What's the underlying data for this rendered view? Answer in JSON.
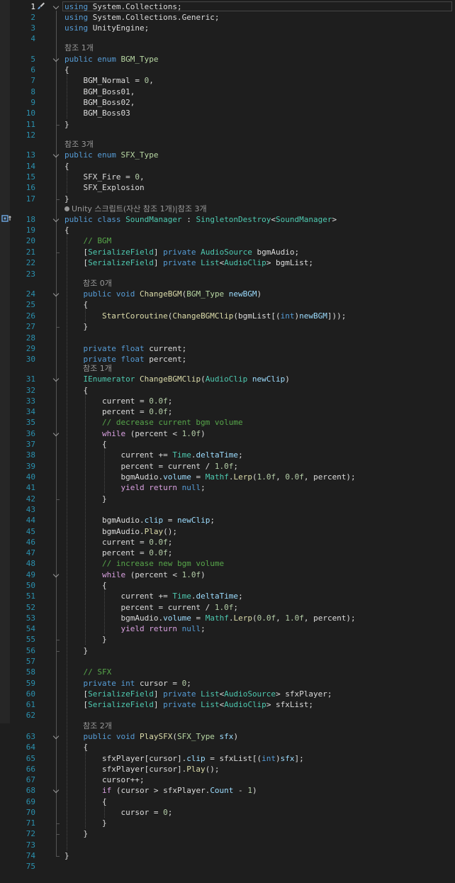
{
  "lenses": {
    "bgm_type": "참조 1개",
    "sfx_type": "참조 3개",
    "sound_manager": "Unity 스크립트(자산 참조 1개)|참조 3개",
    "change_bgm": "참조 0개",
    "change_bgm_clip": "참조 1개",
    "play_sfx": "참조 2개"
  },
  "lines": [
    {
      "n": "1",
      "code": [
        [
          "kw",
          "using"
        ],
        [
          "pl",
          " System.Collections;"
        ]
      ]
    },
    {
      "n": "2",
      "code": [
        [
          "kw",
          "using"
        ],
        [
          "pl",
          " System.Collections.Generic;"
        ]
      ]
    },
    {
      "n": "3",
      "code": [
        [
          "kw",
          "using"
        ],
        [
          "pl",
          " UnityEngine;"
        ]
      ]
    },
    {
      "n": "4",
      "code": []
    },
    {
      "n": "5",
      "code": [
        [
          "kw",
          "public enum "
        ],
        [
          "tyv",
          "BGM_Type"
        ]
      ]
    },
    {
      "n": "6",
      "code": [
        [
          "pl",
          "{"
        ]
      ]
    },
    {
      "n": "7",
      "code": [
        [
          "pl",
          "    BGM_Normal = "
        ],
        [
          "nm",
          "0"
        ],
        [
          "pl",
          ","
        ]
      ]
    },
    {
      "n": "8",
      "code": [
        [
          "pl",
          "    BGM_Boss01,"
        ]
      ]
    },
    {
      "n": "9",
      "code": [
        [
          "pl",
          "    BGM_Boss02,"
        ]
      ]
    },
    {
      "n": "10",
      "code": [
        [
          "pl",
          "    BGM_Boss03"
        ]
      ]
    },
    {
      "n": "11",
      "code": [
        [
          "pl",
          "}"
        ]
      ]
    },
    {
      "n": "12",
      "code": []
    },
    {
      "n": "13",
      "code": [
        [
          "kw",
          "public enum "
        ],
        [
          "tyv",
          "SFX_Type"
        ]
      ]
    },
    {
      "n": "14",
      "code": [
        [
          "pl",
          "{"
        ]
      ]
    },
    {
      "n": "15",
      "code": [
        [
          "pl",
          "    SFX_Fire = "
        ],
        [
          "nm",
          "0"
        ],
        [
          "pl",
          ","
        ]
      ]
    },
    {
      "n": "16",
      "code": [
        [
          "pl",
          "    SFX_Explosion"
        ]
      ]
    },
    {
      "n": "17",
      "code": [
        [
          "pl",
          "}"
        ]
      ]
    },
    {
      "n": "18",
      "code": [
        [
          "kw",
          "public class "
        ],
        [
          "ty",
          "SoundManager"
        ],
        [
          "pl",
          " : "
        ],
        [
          "ty",
          "SingletonDestroy"
        ],
        [
          "pl",
          "<"
        ],
        [
          "ty",
          "SoundManager"
        ],
        [
          "pl",
          ">"
        ]
      ]
    },
    {
      "n": "19",
      "code": [
        [
          "pl",
          "{"
        ]
      ]
    },
    {
      "n": "20",
      "code": [
        [
          "cm",
          "    // BGM"
        ]
      ]
    },
    {
      "n": "21",
      "code": [
        [
          "pl",
          "    ["
        ],
        [
          "ty",
          "SerializeField"
        ],
        [
          "pl",
          "] "
        ],
        [
          "kw",
          "private "
        ],
        [
          "ty",
          "AudioSource"
        ],
        [
          "pl",
          " bgmAudio;"
        ]
      ]
    },
    {
      "n": "22",
      "code": [
        [
          "pl",
          "    ["
        ],
        [
          "ty",
          "SerializeField"
        ],
        [
          "pl",
          "] "
        ],
        [
          "kw",
          "private "
        ],
        [
          "ty",
          "List"
        ],
        [
          "pl",
          "<"
        ],
        [
          "ty",
          "AudioClip"
        ],
        [
          "pl",
          "> bgmList;"
        ]
      ]
    },
    {
      "n": "23",
      "code": []
    },
    {
      "n": "24",
      "code": [
        [
          "kw",
          "    public void "
        ],
        [
          "fn",
          "ChangeBGM"
        ],
        [
          "pl",
          "("
        ],
        [
          "tyv",
          "BGM_Type"
        ],
        [
          "par",
          " newBGM"
        ],
        [
          "pl",
          ")"
        ]
      ]
    },
    {
      "n": "25",
      "code": [
        [
          "pl",
          "    {"
        ]
      ]
    },
    {
      "n": "26",
      "code": [
        [
          "fn",
          "        StartCoroutine"
        ],
        [
          "pl",
          "("
        ],
        [
          "fn",
          "ChangeBGMClip"
        ],
        [
          "pl",
          "(bgmList[("
        ],
        [
          "kw",
          "int"
        ],
        [
          "pl",
          ")"
        ],
        [
          "par",
          "newBGM"
        ],
        [
          "pl",
          "]));"
        ]
      ]
    },
    {
      "n": "27",
      "code": [
        [
          "pl",
          "    }"
        ]
      ]
    },
    {
      "n": "28",
      "code": []
    },
    {
      "n": "29",
      "code": [
        [
          "kw",
          "    private float "
        ],
        [
          "pl",
          "current;"
        ]
      ]
    },
    {
      "n": "30",
      "code": [
        [
          "kw",
          "    private float "
        ],
        [
          "pl",
          "percent;"
        ]
      ]
    },
    {
      "n": "31",
      "code": [
        [
          "ty",
          "    IEnumerator "
        ],
        [
          "fn",
          "ChangeBGMClip"
        ],
        [
          "pl",
          "("
        ],
        [
          "ty",
          "AudioClip"
        ],
        [
          "par",
          " newClip"
        ],
        [
          "pl",
          ")"
        ]
      ]
    },
    {
      "n": "32",
      "code": [
        [
          "pl",
          "    {"
        ]
      ]
    },
    {
      "n": "33",
      "code": [
        [
          "pl",
          "        current = "
        ],
        [
          "nm",
          "0.0f"
        ],
        [
          "pl",
          ";"
        ]
      ]
    },
    {
      "n": "34",
      "code": [
        [
          "pl",
          "        percent = "
        ],
        [
          "nm",
          "0.0f"
        ],
        [
          "pl",
          ";"
        ]
      ]
    },
    {
      "n": "35",
      "code": [
        [
          "cm",
          "        // decrease current bgm volume"
        ]
      ]
    },
    {
      "n": "36",
      "code": [
        [
          "kw2",
          "        while"
        ],
        [
          "pl",
          " (percent < "
        ],
        [
          "nm",
          "1.0f"
        ],
        [
          "pl",
          ")"
        ]
      ]
    },
    {
      "n": "37",
      "code": [
        [
          "pl",
          "        {"
        ]
      ]
    },
    {
      "n": "38",
      "code": [
        [
          "pl",
          "            current += "
        ],
        [
          "ty",
          "Time"
        ],
        [
          "pl",
          "."
        ],
        [
          "par",
          "deltaTime"
        ],
        [
          "pl",
          ";"
        ]
      ]
    },
    {
      "n": "39",
      "code": [
        [
          "pl",
          "            percent = current / "
        ],
        [
          "nm",
          "1.0f"
        ],
        [
          "pl",
          ";"
        ]
      ]
    },
    {
      "n": "40",
      "code": [
        [
          "pl",
          "            bgmAudio."
        ],
        [
          "par",
          "volume"
        ],
        [
          "pl",
          " = "
        ],
        [
          "ty",
          "Mathf"
        ],
        [
          "pl",
          "."
        ],
        [
          "fn",
          "Lerp"
        ],
        [
          "pl",
          "("
        ],
        [
          "nm",
          "1.0f"
        ],
        [
          "pl",
          ", "
        ],
        [
          "nm",
          "0.0f"
        ],
        [
          "pl",
          ", percent);"
        ]
      ]
    },
    {
      "n": "41",
      "code": [
        [
          "kw2",
          "            yield return "
        ],
        [
          "kw",
          "null"
        ],
        [
          "pl",
          ";"
        ]
      ]
    },
    {
      "n": "42",
      "code": [
        [
          "pl",
          "        }"
        ]
      ]
    },
    {
      "n": "43",
      "code": []
    },
    {
      "n": "44",
      "code": [
        [
          "pl",
          "        bgmAudio."
        ],
        [
          "par",
          "clip"
        ],
        [
          "pl",
          " = "
        ],
        [
          "par",
          "newClip"
        ],
        [
          "pl",
          ";"
        ]
      ]
    },
    {
      "n": "45",
      "code": [
        [
          "pl",
          "        bgmAudio."
        ],
        [
          "fn",
          "Play"
        ],
        [
          "pl",
          "();"
        ]
      ]
    },
    {
      "n": "46",
      "code": [
        [
          "pl",
          "        current = "
        ],
        [
          "nm",
          "0.0f"
        ],
        [
          "pl",
          ";"
        ]
      ]
    },
    {
      "n": "47",
      "code": [
        [
          "pl",
          "        percent = "
        ],
        [
          "nm",
          "0.0f"
        ],
        [
          "pl",
          ";"
        ]
      ]
    },
    {
      "n": "48",
      "code": [
        [
          "cm",
          "        // increase new bgm volume"
        ]
      ]
    },
    {
      "n": "49",
      "code": [
        [
          "kw2",
          "        while"
        ],
        [
          "pl",
          " (percent < "
        ],
        [
          "nm",
          "1.0f"
        ],
        [
          "pl",
          ")"
        ]
      ]
    },
    {
      "n": "50",
      "code": [
        [
          "pl",
          "        {"
        ]
      ]
    },
    {
      "n": "51",
      "code": [
        [
          "pl",
          "            current += "
        ],
        [
          "ty",
          "Time"
        ],
        [
          "pl",
          "."
        ],
        [
          "par",
          "deltaTime"
        ],
        [
          "pl",
          ";"
        ]
      ]
    },
    {
      "n": "52",
      "code": [
        [
          "pl",
          "            percent = current / "
        ],
        [
          "nm",
          "1.0f"
        ],
        [
          "pl",
          ";"
        ]
      ]
    },
    {
      "n": "53",
      "code": [
        [
          "pl",
          "            bgmAudio."
        ],
        [
          "par",
          "volume"
        ],
        [
          "pl",
          " = "
        ],
        [
          "ty",
          "Mathf"
        ],
        [
          "pl",
          "."
        ],
        [
          "fn",
          "Lerp"
        ],
        [
          "pl",
          "("
        ],
        [
          "nm",
          "0.0f"
        ],
        [
          "pl",
          ", "
        ],
        [
          "nm",
          "1.0f"
        ],
        [
          "pl",
          ", percent);"
        ]
      ]
    },
    {
      "n": "54",
      "code": [
        [
          "kw2",
          "            yield return "
        ],
        [
          "kw",
          "null"
        ],
        [
          "pl",
          ";"
        ]
      ]
    },
    {
      "n": "55",
      "code": [
        [
          "pl",
          "        }"
        ]
      ]
    },
    {
      "n": "56",
      "code": [
        [
          "pl",
          "    }"
        ]
      ]
    },
    {
      "n": "57",
      "code": []
    },
    {
      "n": "58",
      "code": [
        [
          "cm",
          "    // SFX"
        ]
      ]
    },
    {
      "n": "59",
      "code": [
        [
          "kw",
          "    private int "
        ],
        [
          "pl",
          "cursor = "
        ],
        [
          "nm",
          "0"
        ],
        [
          "pl",
          ";"
        ]
      ]
    },
    {
      "n": "60",
      "code": [
        [
          "pl",
          "    ["
        ],
        [
          "ty",
          "SerializeField"
        ],
        [
          "pl",
          "] "
        ],
        [
          "kw",
          "private "
        ],
        [
          "ty",
          "List"
        ],
        [
          "pl",
          "<"
        ],
        [
          "ty",
          "AudioSource"
        ],
        [
          "pl",
          "> sfxPlayer;"
        ]
      ]
    },
    {
      "n": "61",
      "code": [
        [
          "pl",
          "    ["
        ],
        [
          "ty",
          "SerializeField"
        ],
        [
          "pl",
          "] "
        ],
        [
          "kw",
          "private "
        ],
        [
          "ty",
          "List"
        ],
        [
          "pl",
          "<"
        ],
        [
          "ty",
          "AudioClip"
        ],
        [
          "pl",
          "> sfxList;"
        ]
      ]
    },
    {
      "n": "62",
      "code": []
    },
    {
      "n": "63",
      "code": [
        [
          "kw",
          "    public void "
        ],
        [
          "fn",
          "PlaySFX"
        ],
        [
          "pl",
          "("
        ],
        [
          "tyv",
          "SFX_Type"
        ],
        [
          "par",
          " sfx"
        ],
        [
          "pl",
          ")"
        ]
      ]
    },
    {
      "n": "64",
      "code": [
        [
          "pl",
          "    {"
        ]
      ]
    },
    {
      "n": "65",
      "code": [
        [
          "pl",
          "        sfxPlayer[cursor]."
        ],
        [
          "par",
          "clip"
        ],
        [
          "pl",
          " = sfxList[("
        ],
        [
          "kw",
          "int"
        ],
        [
          "pl",
          ")"
        ],
        [
          "par",
          "sfx"
        ],
        [
          "pl",
          "];"
        ]
      ]
    },
    {
      "n": "66",
      "code": [
        [
          "pl",
          "        sfxPlayer[cursor]."
        ],
        [
          "fn",
          "Play"
        ],
        [
          "pl",
          "();"
        ]
      ]
    },
    {
      "n": "67",
      "code": [
        [
          "pl",
          "        cursor++;"
        ]
      ]
    },
    {
      "n": "68",
      "code": [
        [
          "kw2",
          "        if"
        ],
        [
          "pl",
          " (cursor > sfxPlayer."
        ],
        [
          "par",
          "Count"
        ],
        [
          "pl",
          " - "
        ],
        [
          "nm",
          "1"
        ],
        [
          "pl",
          ")"
        ]
      ]
    },
    {
      "n": "69",
      "code": [
        [
          "pl",
          "        {"
        ]
      ]
    },
    {
      "n": "70",
      "code": [
        [
          "pl",
          "            cursor = "
        ],
        [
          "nm",
          "0"
        ],
        [
          "pl",
          ";"
        ]
      ]
    },
    {
      "n": "71",
      "code": [
        [
          "pl",
          "        }"
        ]
      ]
    },
    {
      "n": "72",
      "code": [
        [
          "pl",
          "    }"
        ]
      ]
    },
    {
      "n": "73",
      "code": []
    },
    {
      "n": "74",
      "code": [
        [
          "pl",
          "}"
        ]
      ]
    },
    {
      "n": "75",
      "code": []
    }
  ],
  "colors": {
    "background": "#1e1e1e",
    "line_number": "#2b91af",
    "keyword": "#569cd6",
    "control_keyword": "#d8a0df",
    "type": "#4ec9b0",
    "enum_type": "#b8d7a3",
    "method": "#dcdcaa",
    "comment": "#57a64a",
    "number": "#b5cea8",
    "parameter": "#9cdcfe"
  },
  "icons": {
    "gutter_top": "brush-icon",
    "gutter_class": "unity-reference-icon",
    "fold": "chevron-down-icon"
  }
}
